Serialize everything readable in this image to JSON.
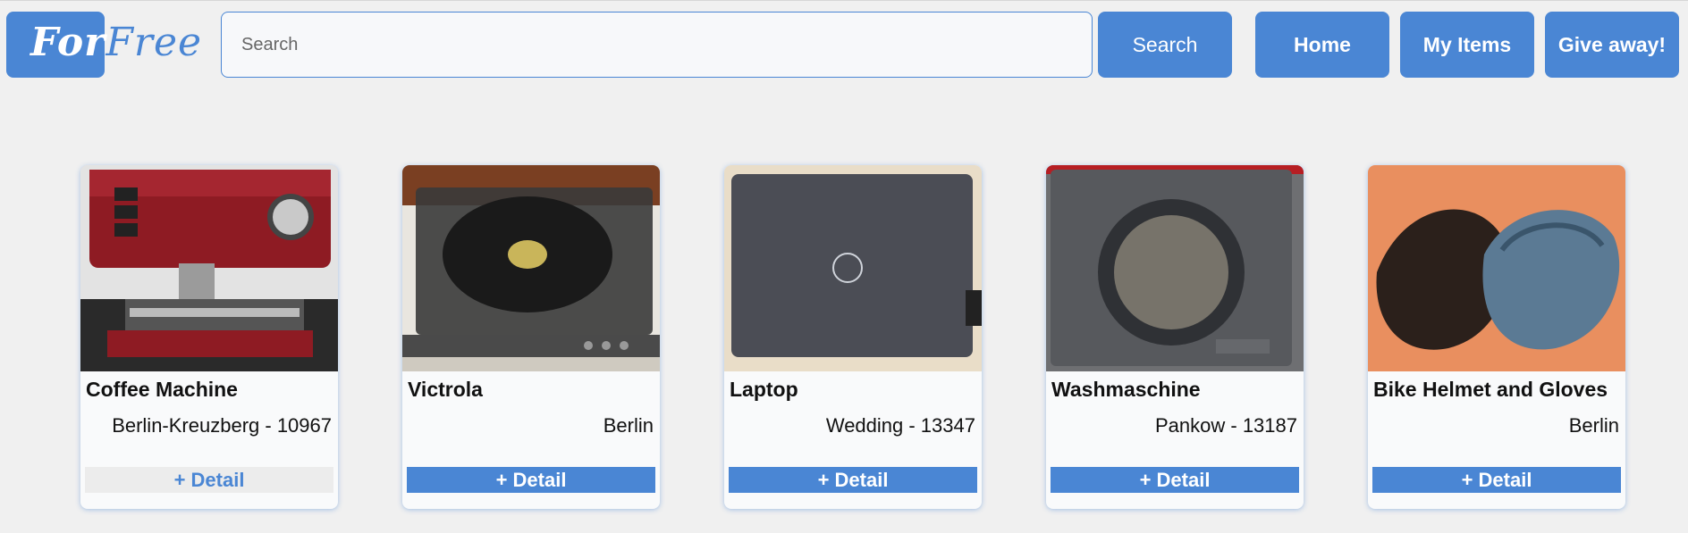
{
  "header": {
    "logo_part1": "For",
    "logo_part2": "Free",
    "search_placeholder": "Search",
    "search_button": "Search",
    "nav": {
      "home": "Home",
      "my_items": "My Items",
      "give_away": "Give away!"
    }
  },
  "colors": {
    "accent": "#4a86d4",
    "background": "#f0f0f0",
    "card": "#f9fafb"
  },
  "items": [
    {
      "title": "Coffee Machine",
      "location": "Berlin-Kreuzberg - 10967",
      "detail": "+ Detail",
      "image": "coffee-machine"
    },
    {
      "title": "Victrola",
      "location": "Berlin",
      "detail": "+ Detail",
      "image": "record-player"
    },
    {
      "title": "Laptop",
      "location": "Wedding - 13347",
      "detail": "+ Detail",
      "image": "laptop"
    },
    {
      "title": "Washmaschine",
      "location": "Pankow - 13187",
      "detail": "+ Detail",
      "image": "washing-machine"
    },
    {
      "title": "Bike Helmet and Gloves",
      "location": "Berlin",
      "detail": "+ Detail",
      "image": "bike-helmet"
    }
  ]
}
